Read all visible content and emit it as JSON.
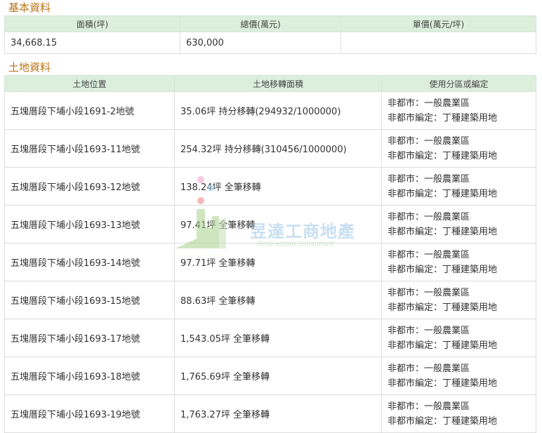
{
  "basic": {
    "title": "基本資料",
    "headers": [
      "面積(坪)",
      "總價(萬元)",
      "單價(萬元/坪)"
    ],
    "row": [
      "34,668.15",
      "630,000",
      ""
    ]
  },
  "land": {
    "title": "土地資料",
    "headers": [
      "土地位置",
      "土地移轉面積",
      "使用分區或編定"
    ],
    "rows": [
      {
        "location": "五塊厝段下埔小段1691-2地號",
        "area": "35.06坪 持分移轉(294932/1000000)",
        "zone1": "非都市：一般農業區",
        "zone2": "非都市編定：丁種建築用地"
      },
      {
        "location": "五塊厝段下埔小段1693-11地號",
        "area": "254.32坪 持分移轉(310456/1000000)",
        "zone1": "非都市：一般農業區",
        "zone2": "非都市編定：丁種建築用地"
      },
      {
        "location": "五塊厝段下埔小段1693-12地號",
        "area": "138.24坪 全筆移轉",
        "zone1": "非都市：一般農業區",
        "zone2": "非都市編定：丁種建築用地"
      },
      {
        "location": "五塊厝段下埔小段1693-13地號",
        "area": "97.41坪 全筆移轉",
        "zone1": "非都市：一般農業區",
        "zone2": "非都市編定：丁種建築用地"
      },
      {
        "location": "五塊厝段下埔小段1693-14地號",
        "area": "97.71坪 全筆移轉",
        "zone1": "非都市：一般農業區",
        "zone2": "非都市編定：丁種建築用地"
      },
      {
        "location": "五塊厝段下埔小段1693-15地號",
        "area": "88.63坪 全筆移轉",
        "zone1": "非都市：一般農業區",
        "zone2": "非都市編定：丁種建築用地"
      },
      {
        "location": "五塊厝段下埔小段1693-17地號",
        "area": "1,543.05坪 全筆移轉",
        "zone1": "非都市：一般農業區",
        "zone2": "非都市編定：丁種建築用地"
      },
      {
        "location": "五塊厝段下埔小段1693-18地號",
        "area": "1,765.69坪 全筆移轉",
        "zone1": "非都市：一般農業區",
        "zone2": "非都市編定：丁種建築用地"
      },
      {
        "location": "五塊厝段下埔小段1693-19地號",
        "area": "1,763.27坪 全筆移轉",
        "zone1": "非都市：一般農業區",
        "zone2": "非都市編定：丁種建築用地"
      }
    ]
  },
  "watermark": {
    "name": "昱達工商地產",
    "subtitle": "Real estate consultant"
  },
  "colors": {
    "section_title": "#b8741a",
    "header_bg": "#dcefdc"
  }
}
